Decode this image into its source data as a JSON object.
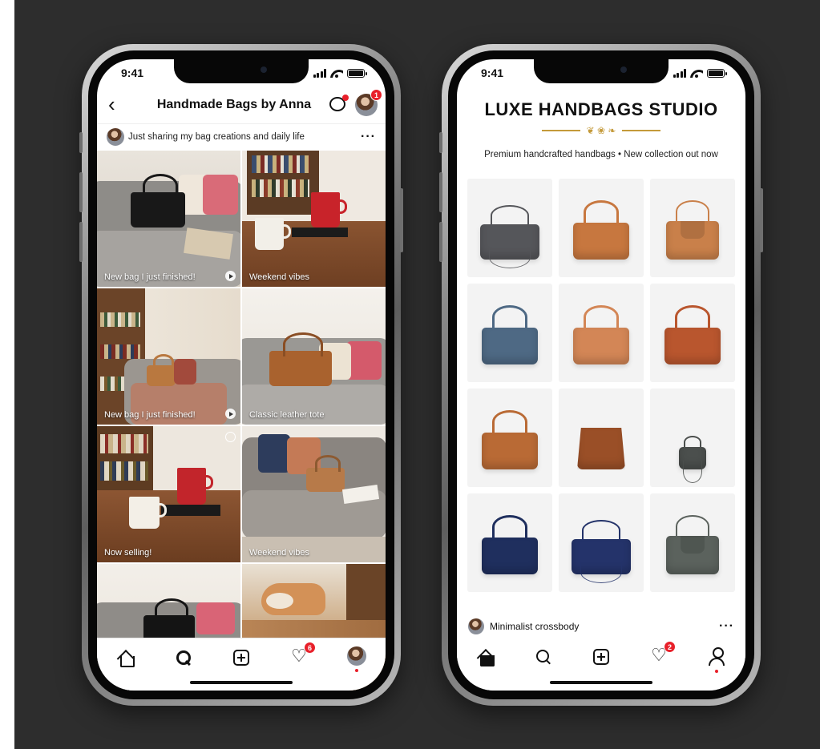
{
  "phone1": {
    "status": {
      "time": "9:41"
    },
    "header": {
      "title": "Handmade Bags by Anna",
      "profile_badge": "1"
    },
    "subbar": {
      "text": "Just sharing my bag creations and daily life"
    },
    "posts": [
      {
        "caption": "New bag I just finished!"
      },
      {
        "caption": "Weekend vibes"
      },
      {
        "caption": "New bag I just finished!"
      },
      {
        "caption": "Classic leather tote"
      },
      {
        "caption": "Now selling!"
      },
      {
        "caption": "Weekend vibes"
      },
      {
        "caption": ""
      },
      {
        "caption": ""
      }
    ],
    "tabbar": {
      "likes_badge": "6"
    }
  },
  "phone2": {
    "status": {
      "time": "9:41"
    },
    "brand": "LUXE HANDBAGS STUDIO",
    "ornament": "❦ ❀ ❧",
    "tagline": "Premium handcrafted handbags • New collection out now",
    "products": [
      {
        "color": "#55565a",
        "style": "crossbody"
      },
      {
        "color": "#c7773f",
        "style": "tote"
      },
      {
        "color": "#c9804a",
        "style": "flap"
      },
      {
        "color": "#4e6984",
        "style": "tote"
      },
      {
        "color": "#d38656",
        "style": "tote"
      },
      {
        "color": "#b9562e",
        "style": "tote"
      },
      {
        "color": "#b96a35",
        "style": "tote"
      },
      {
        "color": "#9a4f27",
        "style": "bucket"
      },
      {
        "color": "#4b4f4d",
        "style": "mini"
      },
      {
        "color": "#1f2f5e",
        "style": "tote"
      },
      {
        "color": "#24336a",
        "style": "crossbody"
      },
      {
        "color": "#5b625d",
        "style": "flap"
      }
    ],
    "post": {
      "name": "Minimalist crossbody"
    },
    "tabbar": {
      "likes_badge": "2"
    }
  },
  "colors": {
    "accent_red": "#e8202a",
    "gold": "#c49a3a",
    "backdrop": "#2d2d2d"
  }
}
